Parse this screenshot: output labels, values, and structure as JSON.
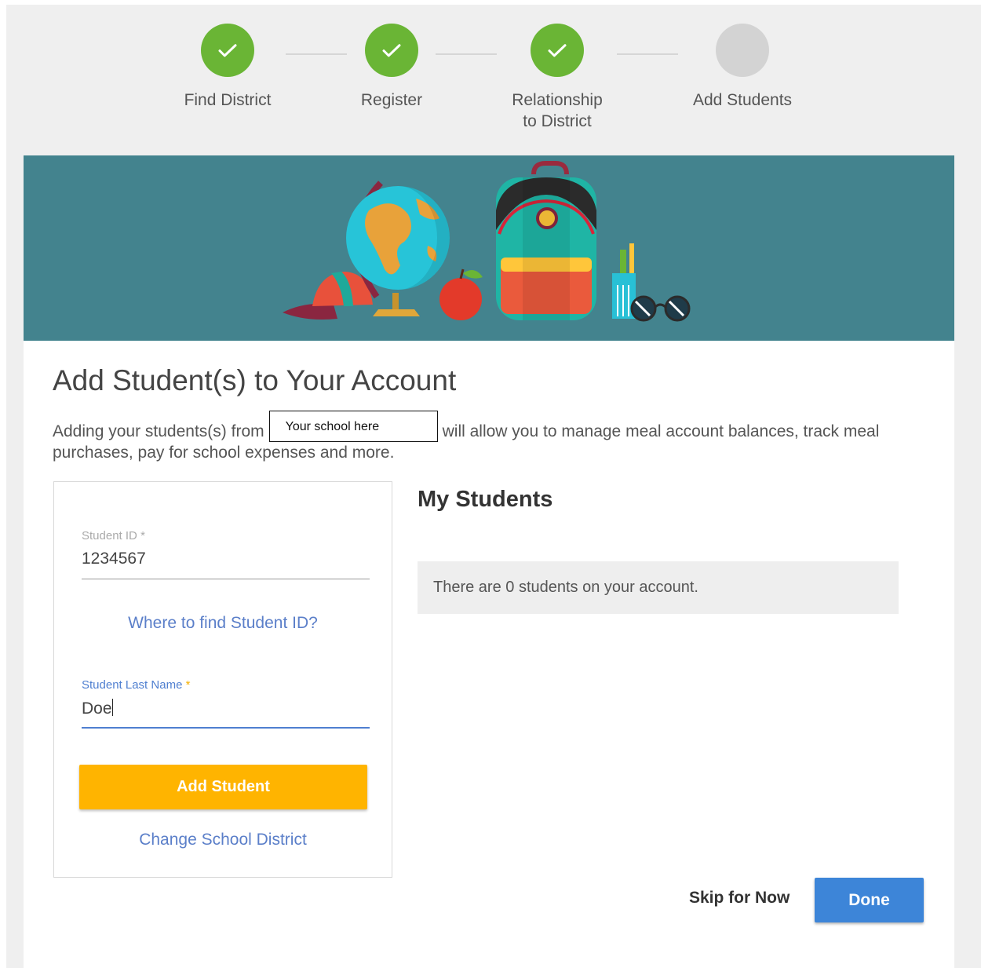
{
  "stepper": {
    "steps": [
      {
        "label": "Find District",
        "status": "complete"
      },
      {
        "label": "Register",
        "status": "complete"
      },
      {
        "label": "Relationship\nto District",
        "status": "complete"
      },
      {
        "label": "Add Students",
        "status": "pending"
      }
    ],
    "icons": {
      "complete": "checkmark-icon"
    }
  },
  "colors": {
    "step_complete": "#6ab535",
    "step_pending": "#d3d3d3",
    "banner": "#43838e",
    "primary_button": "#ffb400",
    "done_button": "#3d85d8",
    "link": "#5b7fc9"
  },
  "banner": {
    "illustration": "school-supplies-illustration"
  },
  "main": {
    "title": "Add Student(s) to Your Account",
    "intro_before": "Adding your students(s) from",
    "school_placeholder": "Your school here",
    "intro_after": "will allow you to manage meal account balances, track meal purchases, pay for school expenses and more."
  },
  "form": {
    "student_id": {
      "label": "Student ID",
      "required_mark": "*",
      "value": "1234567"
    },
    "find_id_link": "Where to find Student ID?",
    "last_name": {
      "label": "Student Last Name",
      "required_mark": "*",
      "value": "Doe"
    },
    "add_button": "Add Student",
    "change_district_link": "Change School District"
  },
  "students": {
    "title": "My Students",
    "empty_message": "There are 0 students on your account."
  },
  "footer": {
    "skip_label": "Skip for Now",
    "done_label": "Done"
  }
}
